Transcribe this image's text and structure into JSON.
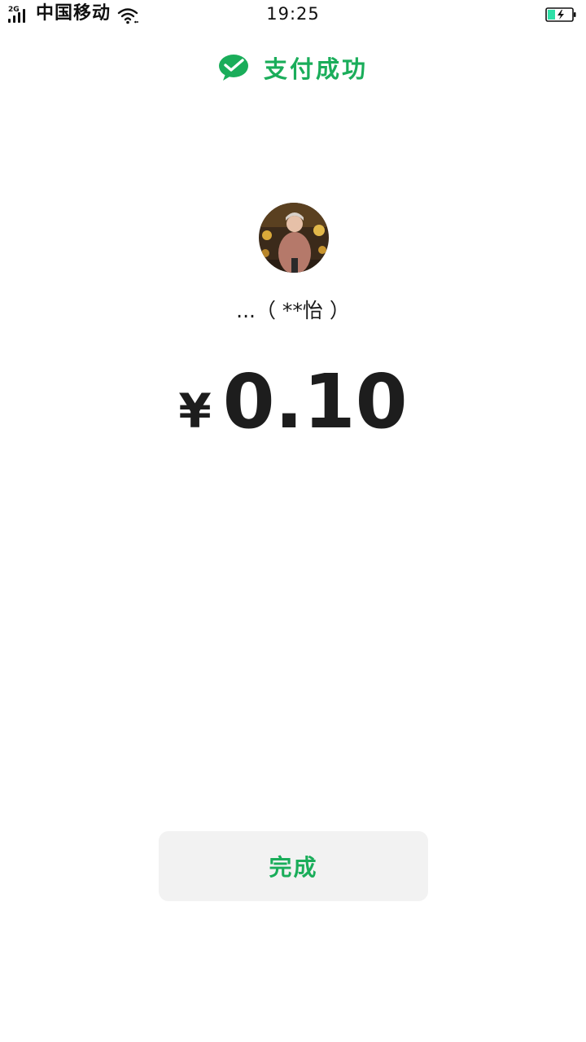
{
  "status_bar": {
    "network_type": "2G",
    "carrier": "中国移动",
    "time": "19:25",
    "battery_color": "#2ee0a8"
  },
  "header": {
    "icon": "wechat-pay-check-icon",
    "title": "支付成功",
    "accent_color": "#1aad5a"
  },
  "payee": {
    "avatar": "avatar-photo",
    "name": "...（ **怡 ）"
  },
  "amount": {
    "currency": "¥",
    "value": "0.10"
  },
  "actions": {
    "done_label": "完成"
  }
}
